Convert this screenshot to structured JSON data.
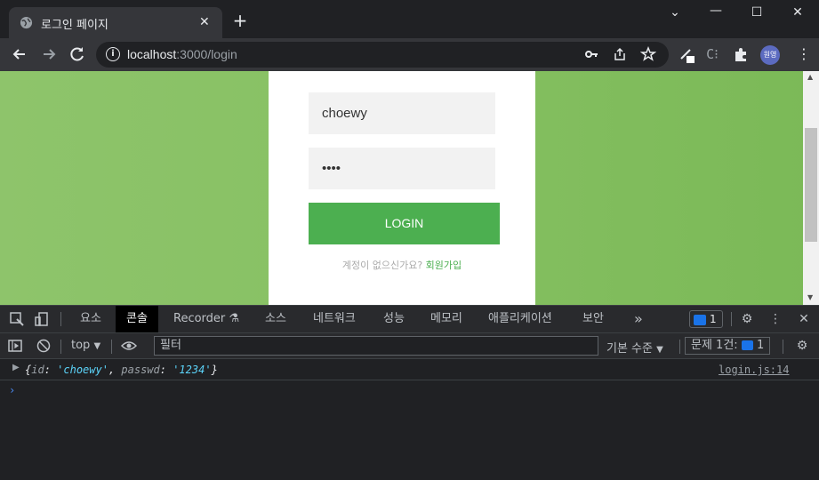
{
  "tab": {
    "title": "로그인 페이지",
    "close": "✕",
    "new_tab": "+"
  },
  "window": {
    "minimize": "⌄",
    "min": "—",
    "max": "☐",
    "close": "✕"
  },
  "toolbar": {
    "url_host": "localhost",
    "url_path": ":3000/login"
  },
  "avatar": "원영",
  "page": {
    "username_value": "choewy",
    "password_value": "••••",
    "login_label": "LOGIN",
    "signup_prompt": "계정이 없으신가요?",
    "signup_link": "회원가입"
  },
  "devtools": {
    "tabs": [
      "요소",
      "콘솔",
      "Recorder",
      "소스",
      "네트워크",
      "성능",
      "메모리",
      "애플리케이션",
      "보안"
    ],
    "active_tab": "콘솔",
    "more": "»",
    "issue_count": "1",
    "context": "top",
    "filter_placeholder": "필터",
    "levels": "기본 수준",
    "issues_label": "문제 1건:",
    "issues_count": "1",
    "log": {
      "open": "{",
      "key1": "id",
      "val1": "'choewy'",
      "key2": "passwd",
      "val2": "'1234'",
      "close": "}",
      "source": "login.js:14"
    },
    "prompt": "›"
  },
  "colors": {
    "accent": "#4caf50",
    "page_bg": "#86c062",
    "devtools_bg": "#202124"
  }
}
